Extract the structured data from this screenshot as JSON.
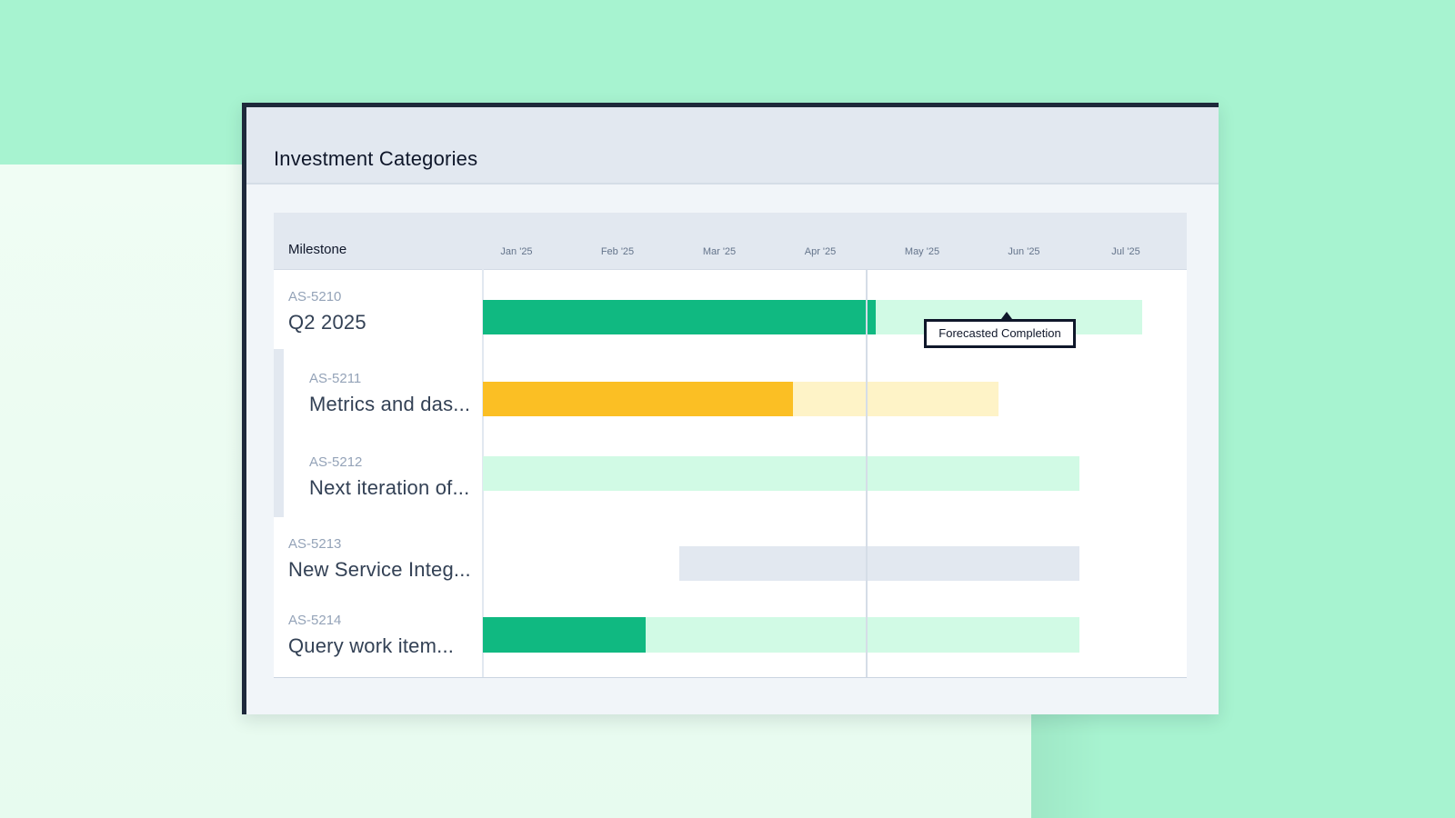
{
  "window": {
    "title": "Investment Categories"
  },
  "timeline": {
    "column_label": "Milestone",
    "months": [
      "Jan '25",
      "Feb '25",
      "Mar '25",
      "Apr '25",
      "May '25",
      "Jun '25",
      "Jul '25"
    ]
  },
  "milestones": [
    {
      "id": "AS-5210",
      "title": "Q2 2025",
      "progress_color": "#10b981",
      "remaining_color": "#d1fae5"
    },
    {
      "id": "AS-5211",
      "title": "Metrics and das...",
      "progress_color": "#fbbf24",
      "remaining_color": "#fef3c7"
    },
    {
      "id": "AS-5212",
      "title": "Next iteration of...",
      "remaining_color": "#d1fae5"
    },
    {
      "id": "AS-5213",
      "title": "New Service Integ...",
      "remaining_color": "#e2e8f0"
    },
    {
      "id": "AS-5214",
      "title": "Query work item...",
      "progress_color": "#10b981",
      "remaining_color": "#d1fae5"
    }
  ],
  "tooltip": {
    "text": "Forecasted Completion"
  }
}
